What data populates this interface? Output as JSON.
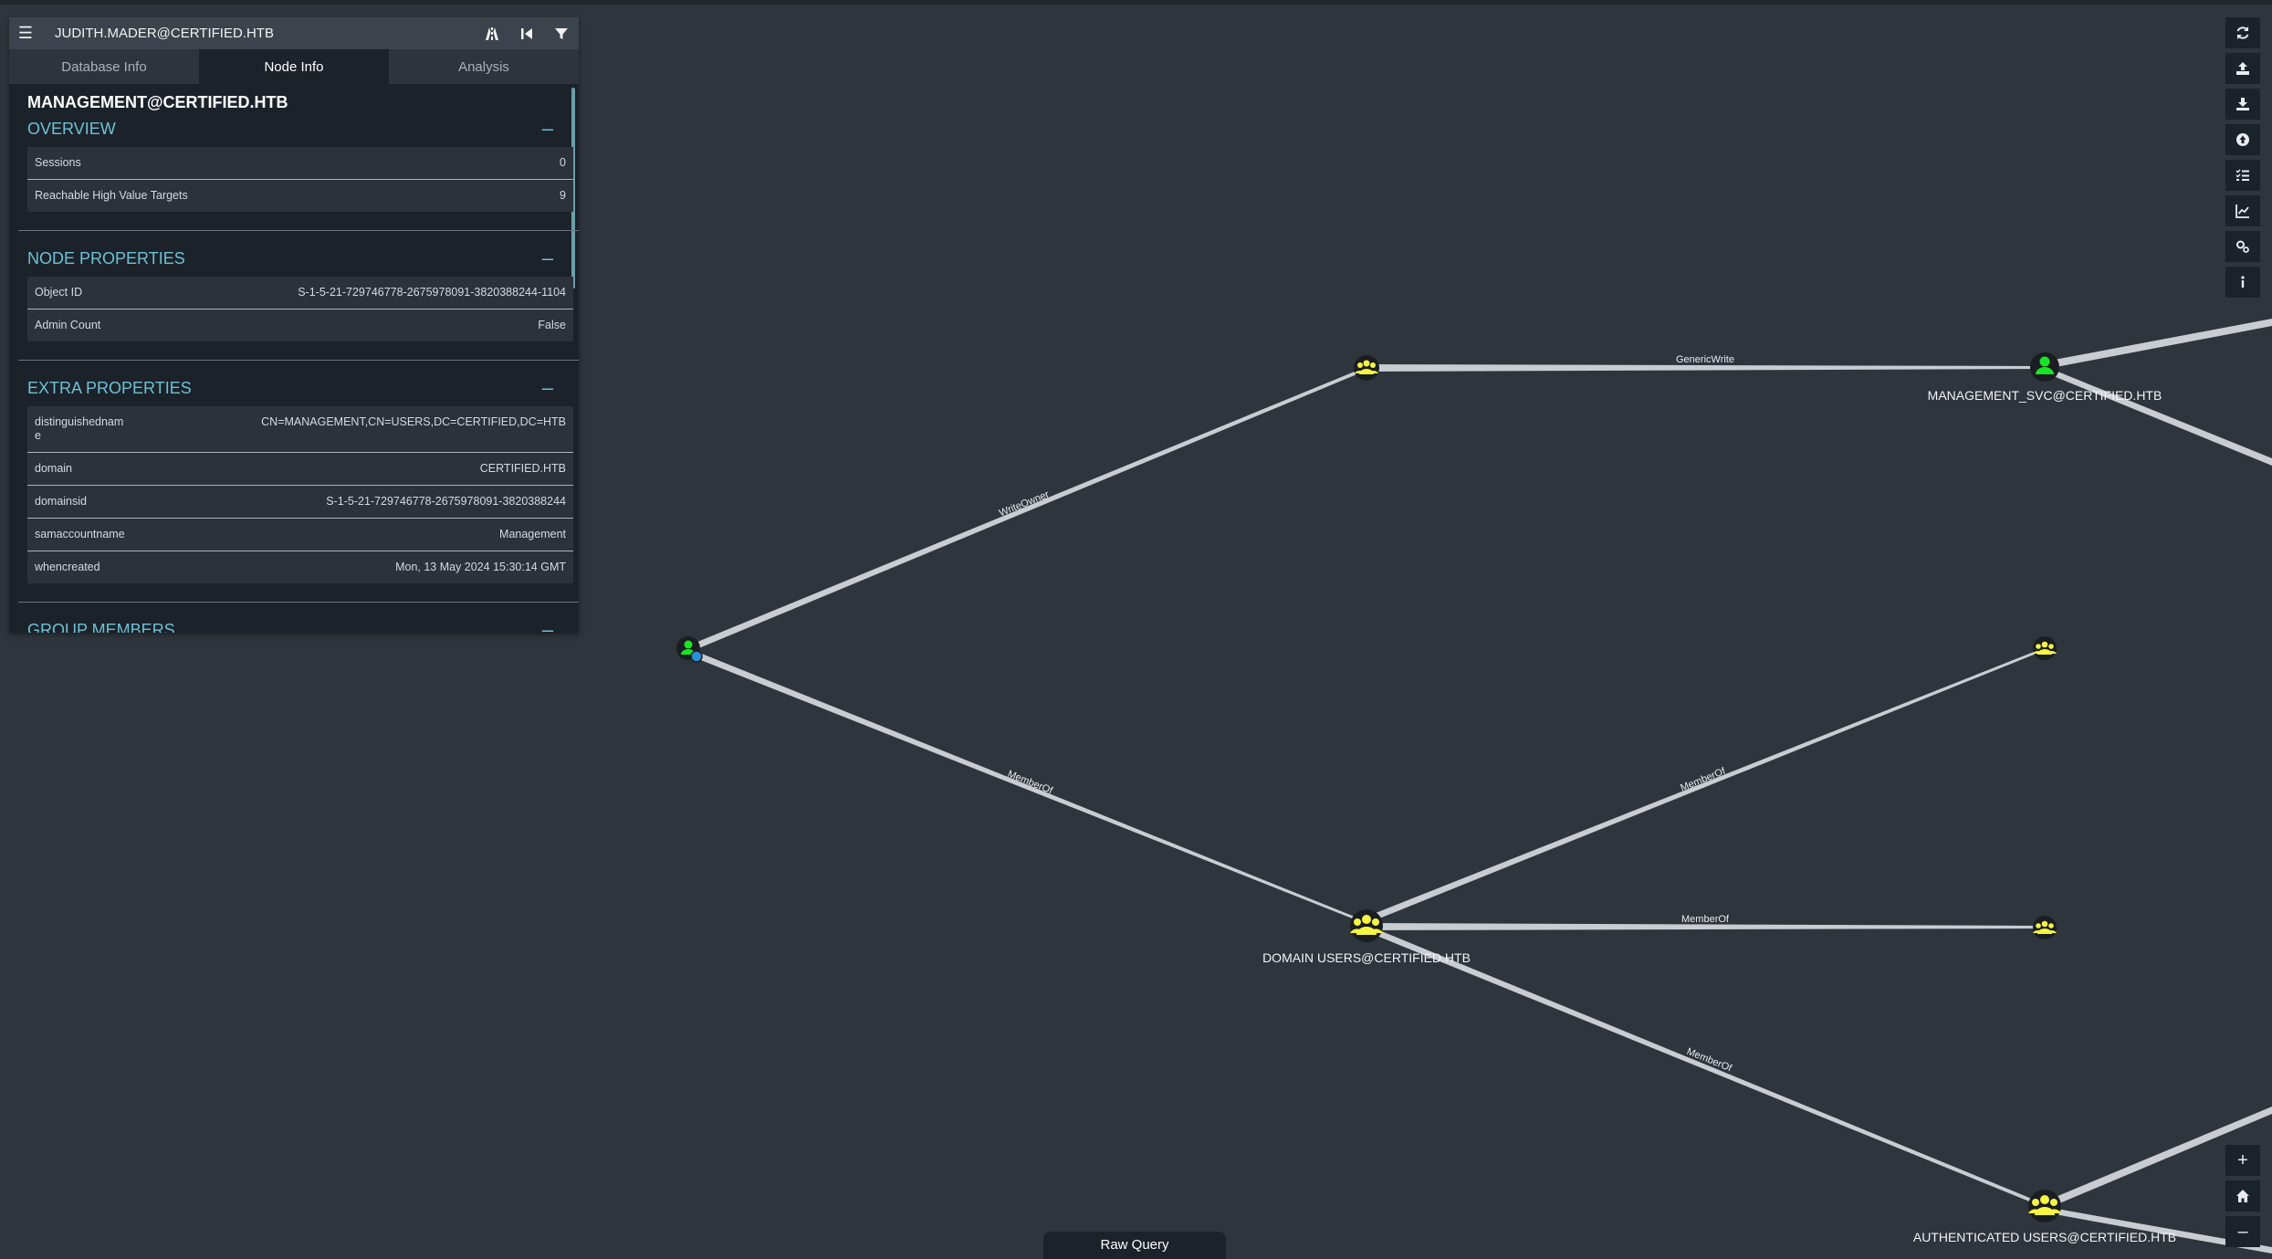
{
  "search": {
    "value": "JUDITH.MADER@CERTIFIED.HTB"
  },
  "tabs": [
    {
      "label": "Database Info"
    },
    {
      "label": "Node Info"
    },
    {
      "label": "Analysis"
    }
  ],
  "node_title": "MANAGEMENT@CERTIFIED.HTB",
  "overview": {
    "heading": "OVERVIEW",
    "rows": [
      {
        "key": "Sessions",
        "value": "0"
      },
      {
        "key": "Reachable High Value Targets",
        "value": "9"
      }
    ]
  },
  "node_properties": {
    "heading": "NODE PROPERTIES",
    "rows": [
      {
        "key": "Object ID",
        "value": "S-1-5-21-729746778-2675978091-3820388244-1104"
      },
      {
        "key": "Admin Count",
        "value": "False"
      }
    ]
  },
  "extra_properties": {
    "heading": "EXTRA PROPERTIES",
    "rows": [
      {
        "key": "distinguishedname",
        "value": "CN=MANAGEMENT,CN=USERS,DC=CERTIFIED,DC=HTB"
      },
      {
        "key": "domain",
        "value": "CERTIFIED.HTB"
      },
      {
        "key": "domainsid",
        "value": "S-1-5-21-729746778-2675978091-3820388244"
      },
      {
        "key": "samaccountname",
        "value": "Management"
      },
      {
        "key": "whencreated",
        "value": "Mon, 13 May 2024 15:30:14 GMT"
      }
    ]
  },
  "group_members": {
    "heading": "GROUP MEMBERS"
  },
  "graph": {
    "edges": {
      "writeowner": "WriteOwner",
      "genericwrite": "GenericWrite",
      "memberof_1": "MemberOf",
      "memberof_2": "MemberOf",
      "memberof_3": "MemberOf",
      "memberof_4": "MemberOf"
    },
    "nodes": {
      "management_svc": "MANAGEMENT_SVC@CERTIFIED.HTB",
      "domain_users": "DOMAIN USERS@CERTIFIED.HTB",
      "authenticated_users": "AUTHENTICATED USERS@CERTIFIED.HTB"
    }
  },
  "raw_query": {
    "label": "Raw Query"
  },
  "colors": {
    "background": "#2f353c",
    "panel": "#1c222a",
    "accent": "#6ec0d4",
    "group_node": "#f5f542",
    "user_node": "#17e625"
  }
}
